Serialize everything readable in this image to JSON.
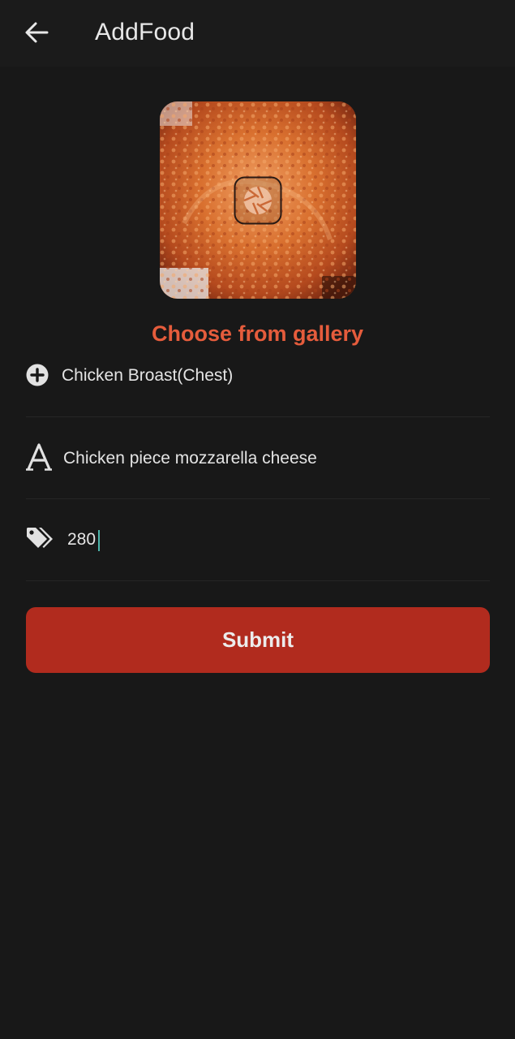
{
  "app_bar": {
    "title": "AddFood",
    "back_icon": "arrow-left-icon"
  },
  "image_picker": {
    "overlay_icon": "camera-shutter-icon"
  },
  "gallery_link": "Choose from gallery",
  "form": {
    "fields": [
      {
        "icon": "plus-circle-icon",
        "value": "Chicken Broast(Chest)"
      },
      {
        "icon": "letter-a-icon",
        "value": "Chicken piece mozzarella cheese"
      },
      {
        "icon": "price-tags-icon",
        "value": "280"
      }
    ],
    "submit_label": "Submit"
  },
  "colors": {
    "background": "#181818",
    "accent_text": "#e55c3c",
    "button": "#b12b1e",
    "caret": "#4db6ac"
  }
}
